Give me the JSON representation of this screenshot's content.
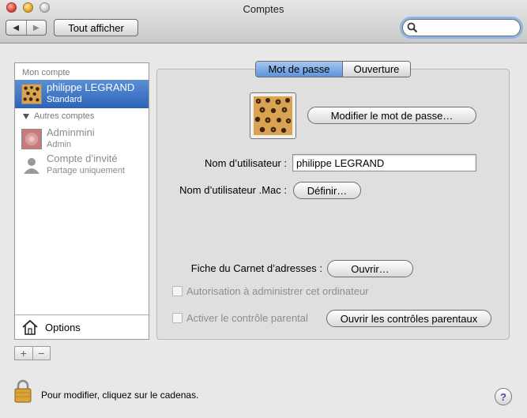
{
  "window": {
    "title": "Comptes"
  },
  "toolbar": {
    "back_label": "◀",
    "forward_label": "▶",
    "show_all_label": "Tout afficher"
  },
  "search": {
    "value": "",
    "placeholder": ""
  },
  "sidebar": {
    "my_account_header": "Mon compte",
    "my_account": {
      "name": "philippe LEGRAND",
      "type": "Standard"
    },
    "other_accounts_header": "Autres comptes",
    "other_accounts": [
      {
        "name": "Adminmini",
        "type": "Admin"
      },
      {
        "name": "Compte d’invité",
        "type": "Partage uniquement"
      }
    ],
    "options_label": "Options",
    "add_label": "+",
    "remove_label": "−"
  },
  "tabs": {
    "password": "Mot de passe",
    "login": "Ouverture"
  },
  "main": {
    "change_password_label": "Modifier le mot de passe…",
    "username_label": "Nom d’utilisateur :",
    "username_value": "philippe LEGRAND",
    "mac_username_label": "Nom d’utilisateur .Mac :",
    "define_label": "Définir…",
    "address_book_label": "Fiche du Carnet d’adresses :",
    "open_label": "Ouvrir…",
    "allow_admin_label": "Autorisation à administrer cet ordinateur",
    "parental_label": "Activer le contrôle parental",
    "open_parental_label": "Ouvrir les contrôles parentaux"
  },
  "footer": {
    "lock_text": "Pour modifier, cliquez sur le cadenas.",
    "help_label": "?"
  },
  "colors": {
    "selection": "#3a72c4",
    "tab_active": "#6fa0e2"
  }
}
